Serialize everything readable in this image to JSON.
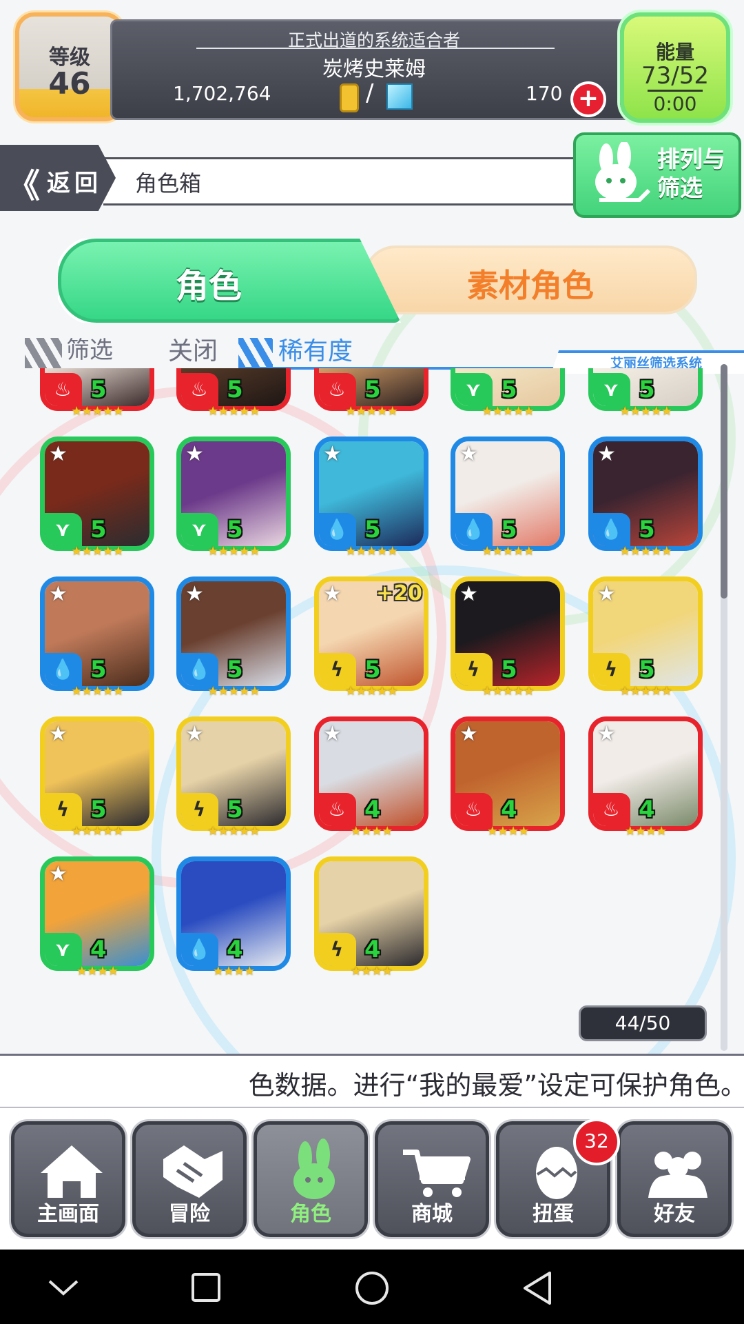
{
  "status": {
    "level_label": "等级",
    "level": "46",
    "title": "正式出道的系统适合者",
    "player_name": "炭烤史莱姆",
    "coins": "1,702,764",
    "separator": "/",
    "gems": "170",
    "plus": "+",
    "energy_label": "能量",
    "energy_value": "73/52",
    "energy_timer": "0:00"
  },
  "header": {
    "back_chevron": "《",
    "back_label": "返回",
    "title": "角色箱",
    "sort_label": "排列与筛选"
  },
  "tabs": [
    {
      "label": "角色",
      "active": true
    },
    {
      "label": "素材角色",
      "active": false
    }
  ],
  "filter": {
    "filter_label": "筛选",
    "filter_value": "关闭",
    "sort_value": "稀有度",
    "system_label": "艾丽丝筛选系统"
  },
  "elements": {
    "fire": {
      "color": "#e8232c",
      "glyph": "♨"
    },
    "wind": {
      "color": "#27c95a",
      "glyph": "⋎"
    },
    "water": {
      "color": "#1f8ae6",
      "glyph": "💧"
    },
    "thunder": {
      "color": "#f2cf1f",
      "glyph": "ϟ"
    }
  },
  "cards": [
    {
      "element": "fire",
      "level": "5",
      "stars": "★★★★★",
      "favorite": false,
      "bonus": "",
      "art": [
        "#f1e6dd",
        "#3b2a2a"
      ]
    },
    {
      "element": "fire",
      "level": "5",
      "stars": "★★★★★",
      "favorite": false,
      "bonus": "",
      "art": [
        "#5a3d2a",
        "#1e1614"
      ]
    },
    {
      "element": "fire",
      "level": "5",
      "stars": "★★★★★",
      "favorite": false,
      "bonus": "",
      "art": [
        "#d9a36a",
        "#2c2020"
      ]
    },
    {
      "element": "wind",
      "level": "5",
      "stars": "★★★★★",
      "favorite": false,
      "bonus": "",
      "art": [
        "#f4e9c9",
        "#e6c8a0"
      ]
    },
    {
      "element": "wind",
      "level": "5",
      "stars": "★★★★★",
      "favorite": false,
      "bonus": "",
      "art": [
        "#f5f0e6",
        "#d7cfc5"
      ]
    },
    {
      "element": "wind",
      "level": "5",
      "stars": "★★★★★",
      "favorite": true,
      "bonus": "",
      "art": [
        "#7a2a1a",
        "#2a2c30"
      ]
    },
    {
      "element": "wind",
      "level": "5",
      "stars": "★★★★★",
      "favorite": true,
      "bonus": "",
      "art": [
        "#6c3a8a",
        "#e9d6e0"
      ]
    },
    {
      "element": "water",
      "level": "5",
      "stars": "★★★★★",
      "favorite": true,
      "bonus": "",
      "art": [
        "#3fb8d9",
        "#1c2a5a"
      ]
    },
    {
      "element": "water",
      "level": "5",
      "stars": "★★★★★",
      "favorite": true,
      "bonus": "",
      "art": [
        "#f1ece8",
        "#e27a68"
      ]
    },
    {
      "element": "water",
      "level": "5",
      "stars": "★★★★★",
      "favorite": true,
      "bonus": "",
      "art": [
        "#3a2430",
        "#b8453a"
      ]
    },
    {
      "element": "water",
      "level": "5",
      "stars": "★★★★★",
      "favorite": true,
      "bonus": "",
      "art": [
        "#c07a5a",
        "#4a2c1c"
      ]
    },
    {
      "element": "water",
      "level": "5",
      "stars": "★★★★★",
      "favorite": true,
      "bonus": "",
      "art": [
        "#6a4030",
        "#d8dde8"
      ]
    },
    {
      "element": "thunder",
      "level": "5",
      "stars": "★★★★★",
      "favorite": true,
      "bonus": "+20",
      "art": [
        "#f4d6b0",
        "#c0552e"
      ]
    },
    {
      "element": "thunder",
      "level": "5",
      "stars": "★★★★★",
      "favorite": true,
      "bonus": "",
      "art": [
        "#1c1a1e",
        "#b8242a"
      ]
    },
    {
      "element": "thunder",
      "level": "5",
      "stars": "★★★★★",
      "favorite": true,
      "bonus": "",
      "art": [
        "#f2d67a",
        "#dfe6ea"
      ]
    },
    {
      "element": "thunder",
      "level": "5",
      "stars": "★★★★★",
      "favorite": true,
      "bonus": "",
      "art": [
        "#f0c25a",
        "#2a2a30"
      ]
    },
    {
      "element": "thunder",
      "level": "5",
      "stars": "★★★★★",
      "favorite": true,
      "bonus": "",
      "art": [
        "#e6d2a8",
        "#2c2a2e"
      ]
    },
    {
      "element": "fire",
      "level": "4",
      "stars": "★★★★",
      "favorite": true,
      "bonus": "",
      "art": [
        "#d9dde3",
        "#c0502a"
      ]
    },
    {
      "element": "fire",
      "level": "4",
      "stars": "★★★★",
      "favorite": true,
      "bonus": "",
      "art": [
        "#c0642e",
        "#d8a44a"
      ]
    },
    {
      "element": "fire",
      "level": "4",
      "stars": "★★★★",
      "favorite": true,
      "bonus": "",
      "art": [
        "#f2ece8",
        "#7a8a6a"
      ]
    },
    {
      "element": "wind",
      "level": "4",
      "stars": "★★★★",
      "favorite": true,
      "bonus": "",
      "art": [
        "#f2a33a",
        "#3a8fd0"
      ]
    },
    {
      "element": "water",
      "level": "4",
      "stars": "★★★★",
      "favorite": false,
      "bonus": "",
      "art": [
        "#2a4cc0",
        "#e6eaf0"
      ]
    },
    {
      "element": "thunder",
      "level": "4",
      "stars": "★★★★",
      "favorite": false,
      "bonus": "",
      "art": [
        "#e6d2a8",
        "#2c2a2e"
      ]
    }
  ],
  "count": "44/50",
  "message": "色数据。进行“我的最爱”设定可保护角色。",
  "nav": [
    {
      "label": "主画面",
      "icon": "home-icon"
    },
    {
      "label": "冒险",
      "icon": "handshake-icon"
    },
    {
      "label": "角色",
      "icon": "bunny-icon"
    },
    {
      "label": "商城",
      "icon": "cart-icon"
    },
    {
      "label": "扭蛋",
      "icon": "egg-icon"
    },
    {
      "label": "好友",
      "icon": "friends-icon"
    }
  ],
  "gacha_badge": "32"
}
